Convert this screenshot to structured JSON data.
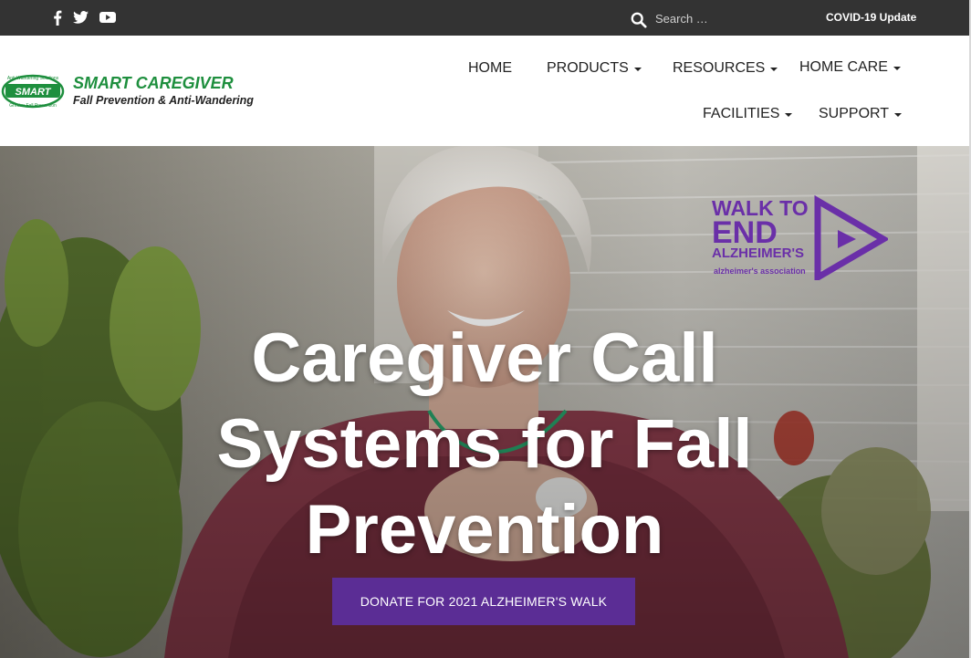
{
  "topbar": {
    "social": [
      {
        "icon": "facebook-icon"
      },
      {
        "icon": "twitter-icon"
      },
      {
        "icon": "youtube-icon"
      }
    ],
    "search": {
      "placeholder": "Search …",
      "value": ""
    },
    "covid_link": "COVID-19 Update"
  },
  "header": {
    "logo": {
      "brand": "SMART CAREGIVER",
      "tagline": "Fall Prevention & Anti-Wandering",
      "badge_top": "Anti-Wandering Solutions",
      "badge_center": "SMART",
      "badge_bottom": "Greater Fall Prevention"
    },
    "nav": {
      "home": "HOME",
      "products": "PRODUCTS",
      "resources": "RESOURCES",
      "home_care": "HOME CARE",
      "facilities": "FACILITIES",
      "support": "SUPPORT"
    }
  },
  "hero": {
    "title_lines": [
      "Caregiver Call",
      "Systems for Fall",
      "Prevention"
    ],
    "donate_label": "DONATE FOR 2021 ALZHEIMER'S WALK",
    "walk_logo": {
      "line1": "WALK TO",
      "line2": "END",
      "line3": "ALZHEIMER'S",
      "org": "alzheimer's association"
    }
  },
  "colors": {
    "topbar": "#333333",
    "brand_green": "#1e8f3e",
    "walk_purple": "#6a2fa8",
    "donate_button": "#5b2d95"
  }
}
